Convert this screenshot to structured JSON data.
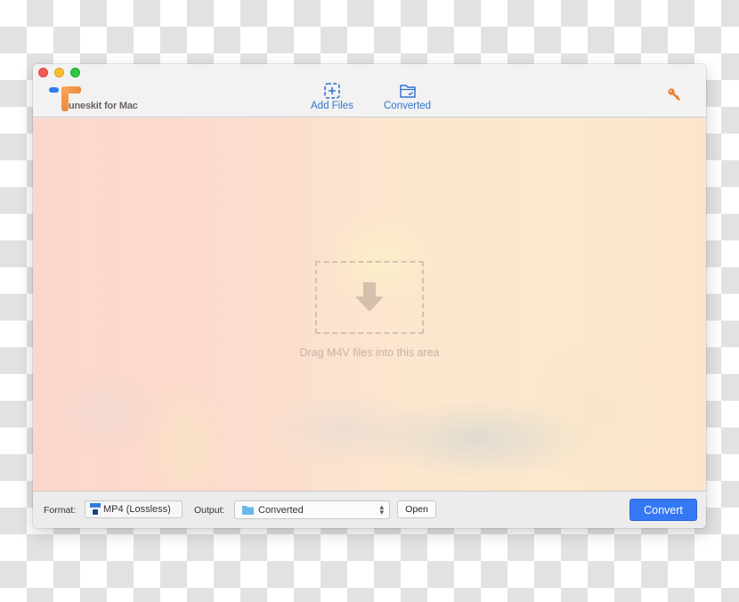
{
  "app": {
    "title": "uneskit for Mac",
    "brand_colors": {
      "blue": "#2f7bf0",
      "orange": "#f08a3c"
    }
  },
  "toolbar": {
    "add_files_label": "Add Files",
    "add_files_icon": "add-files-icon",
    "converted_label": "Converted",
    "converted_icon": "folder-check-icon",
    "register_icon": "key-icon",
    "accent_color": "#2f74d0"
  },
  "drop_area": {
    "icon": "download-arrow-icon",
    "hint_text": "Drag M4V files into this area"
  },
  "bottom_bar": {
    "format_label": "Format:",
    "format_value": "MP4 (Lossless)",
    "output_label": "Output:",
    "output_value": "Converted",
    "open_label": "Open",
    "convert_label": "Convert",
    "convert_color": "#3478f6"
  }
}
